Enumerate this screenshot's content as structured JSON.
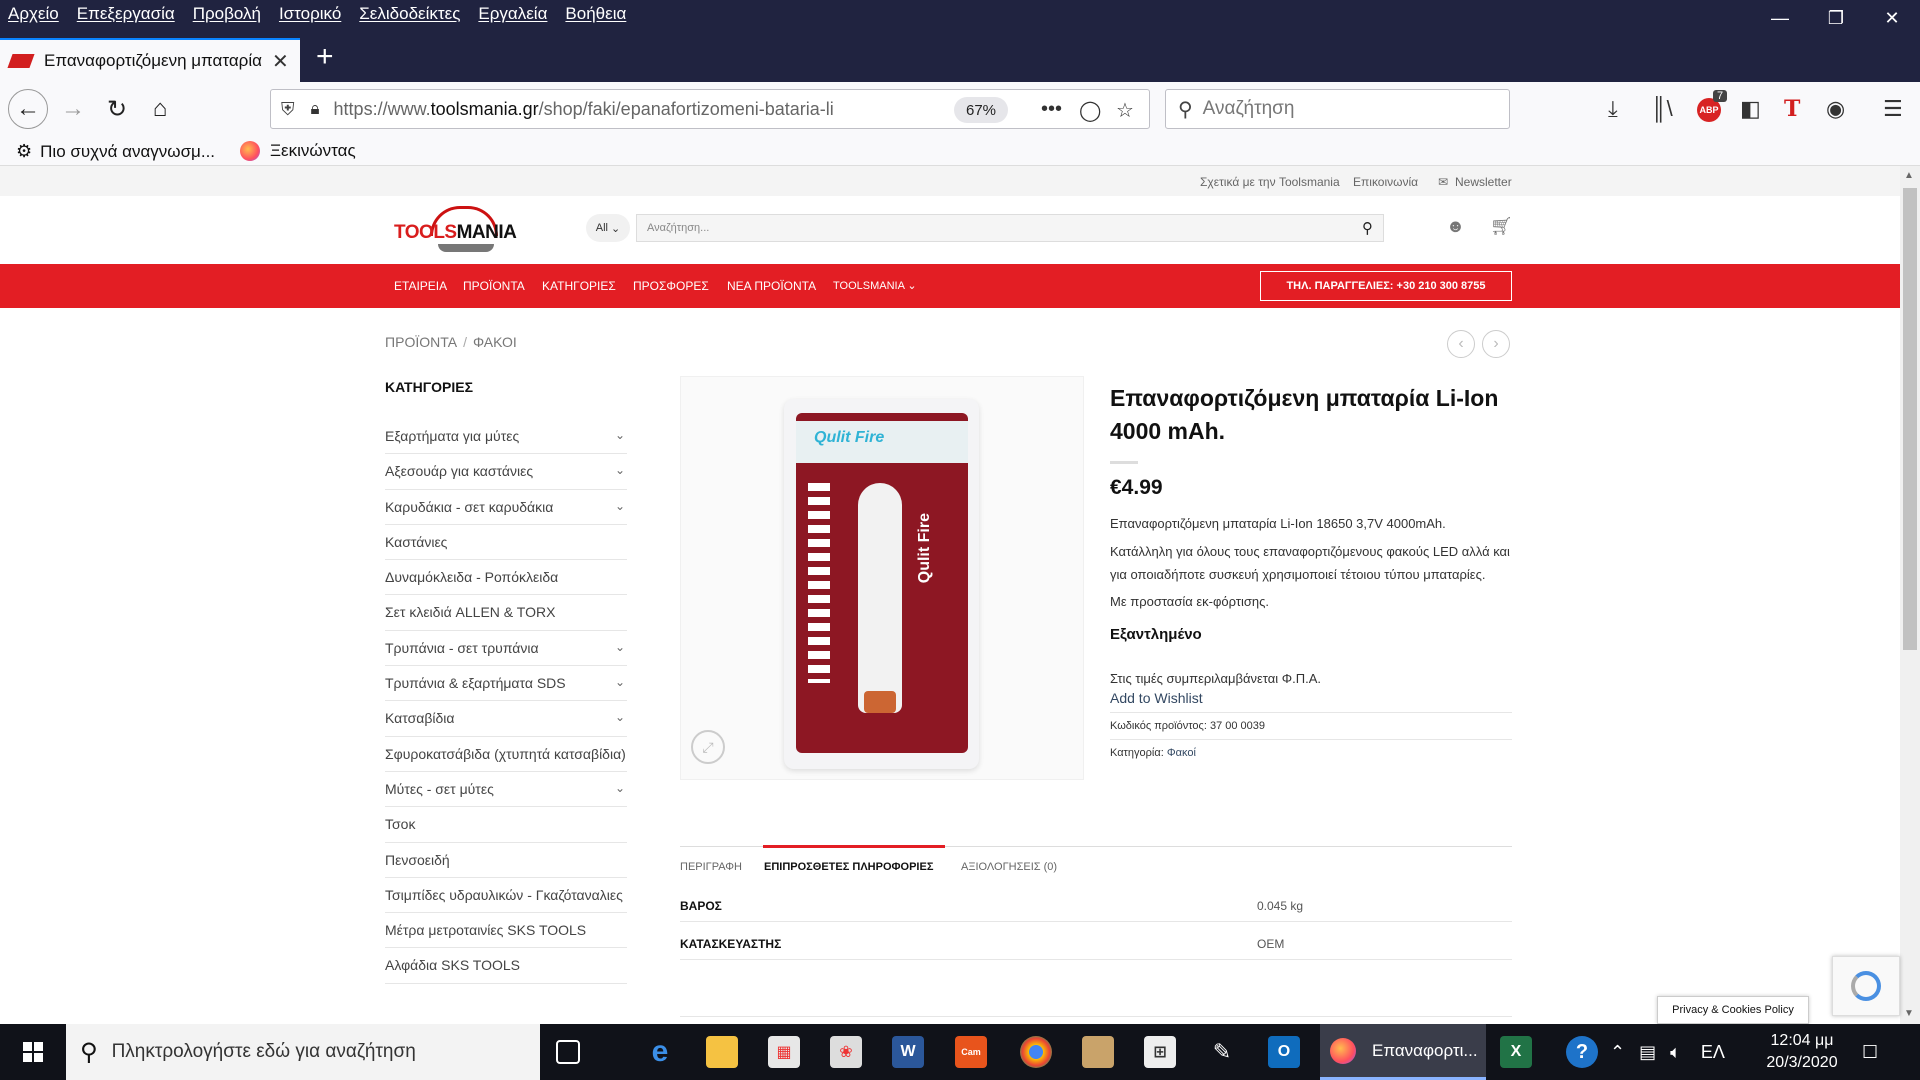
{
  "browser": {
    "menu": [
      "Αρχείο",
      "Επεξεργασία",
      "Προβολή",
      "Ιστορικό",
      "Σελιδοδείκτες",
      "Εργαλεία",
      "Βοήθεια"
    ],
    "tab_title": "Επαναφορτιζόμενη μπαταρία",
    "url_prefix": "https://www.",
    "url_domain": "toolsmania.gr",
    "url_path": "/shop/faki/epanafortizomeni-bataria-li",
    "zoom": "67%",
    "search_placeholder": "Αναζήτηση",
    "abp_count": "7",
    "bookmarks": [
      "Πιο συχνά αναγνωσμ...",
      "Ξεκινώντας"
    ]
  },
  "site": {
    "top_links": [
      "Σχετικά με την Toolsmania",
      "Επικοινωνία",
      "Newsletter"
    ],
    "logo_red": "TOOLS",
    "logo_black": "MANIA",
    "search_scope": "All",
    "search_placeholder": "Αναζήτηση...",
    "nav": [
      "ΕΤΑΙΡΕΙΑ",
      "ΠΡΟΪΟΝΤΑ",
      "ΚΑΤΗΓΟΡΙΕΣ",
      "ΠΡΟΣΦΟΡΕΣ",
      "ΝΕΑ ΠΡΟΪΟΝΤΑ",
      "TOOLSMANIA"
    ],
    "phone": "ΤΗΛ. ΠΑΡΑΓΓΕΛΙΕΣ: +30 210 300 8755",
    "breadcrumb": [
      "ΠΡΟΪΟΝΤΑ",
      "ΦΑΚΟΙ"
    ],
    "categories_title": "ΚΑΤΗΓΟΡΙΕΣ",
    "categories": [
      "Εξαρτήματα για μύτες",
      "Αξεσουάρ για καστάνιες",
      "Καρυδάκια - σετ καρυδάκια",
      "Καστάνιες",
      "Δυναμόκλειδα - Ροπόκλειδα",
      "Σετ κλειδιά ALLEN & TORX",
      "Τρυπάνια - σετ τρυπάνια",
      "Τρυπάνια & εξαρτήματα SDS",
      "Κατσαβίδια",
      "Σφυροκατσάβιδα (χτυπητά κατσαβίδια)",
      "Μύτες - σετ μύτες",
      "Τσοκ",
      "Πενσοειδή",
      "Τσιμπίδες υδραυλικών - Γκαζόταναλιες",
      "Μέτρα μετροταινίες SKS TOOLS",
      "Αλφάδια SKS TOOLS"
    ],
    "image_brand": "Qulit Fire",
    "product": {
      "title": "Επαναφορτιζόμενη μπαταρία Li-Ion 4000 mAh.",
      "price": "€4.99",
      "desc1": "Επαναφορτιζόμενη μπαταρία Li-Ion 18650 3,7V 4000mAh.",
      "desc2": "Κατάλληλη για όλους τους επαναφορτιζόμενους φακούς LED αλλά και για οποιαδήποτε συσκευή χρησιμοποιεί τέτοιου τύπου μπαταρίες.",
      "desc3": "Με προστασία εκ-φόρτισης.",
      "stock": "Εξαντλημένο",
      "tax": "Στις τιμές συμπεριλαμβάνεται Φ.Π.Α.",
      "wishlist": "Add to Wishlist",
      "sku_label": "Κωδικός προϊόντος:",
      "sku": "37 00 0039",
      "category_label": "Κατηγορία:",
      "category": "Φακοί"
    },
    "tabs": [
      "ΠΕΡΙΓΡΑΦΗ",
      "ΕΠΙΠΡΟΣΘΕΤΕΣ ΠΛΗΡΟΦΟΡΙΕΣ",
      "ΑΞΙΟΛΟΓΗΣΕΙΣ (0)"
    ],
    "attributes": [
      {
        "k": "ΒΑΡΟΣ",
        "v": "0.045 kg"
      },
      {
        "k": "ΚΑΤΑΣΚΕΥΑΣΤΗΣ",
        "v": "OEM"
      }
    ],
    "privacy": "Privacy & Cookies Policy"
  },
  "taskbar": {
    "search_placeholder": "Πληκτρολογήστε εδώ για αναζήτηση",
    "active_app": "Επαναφορτι...",
    "lang": "ΕΛ",
    "time": "12:04 μμ",
    "date": "20/3/2020"
  }
}
